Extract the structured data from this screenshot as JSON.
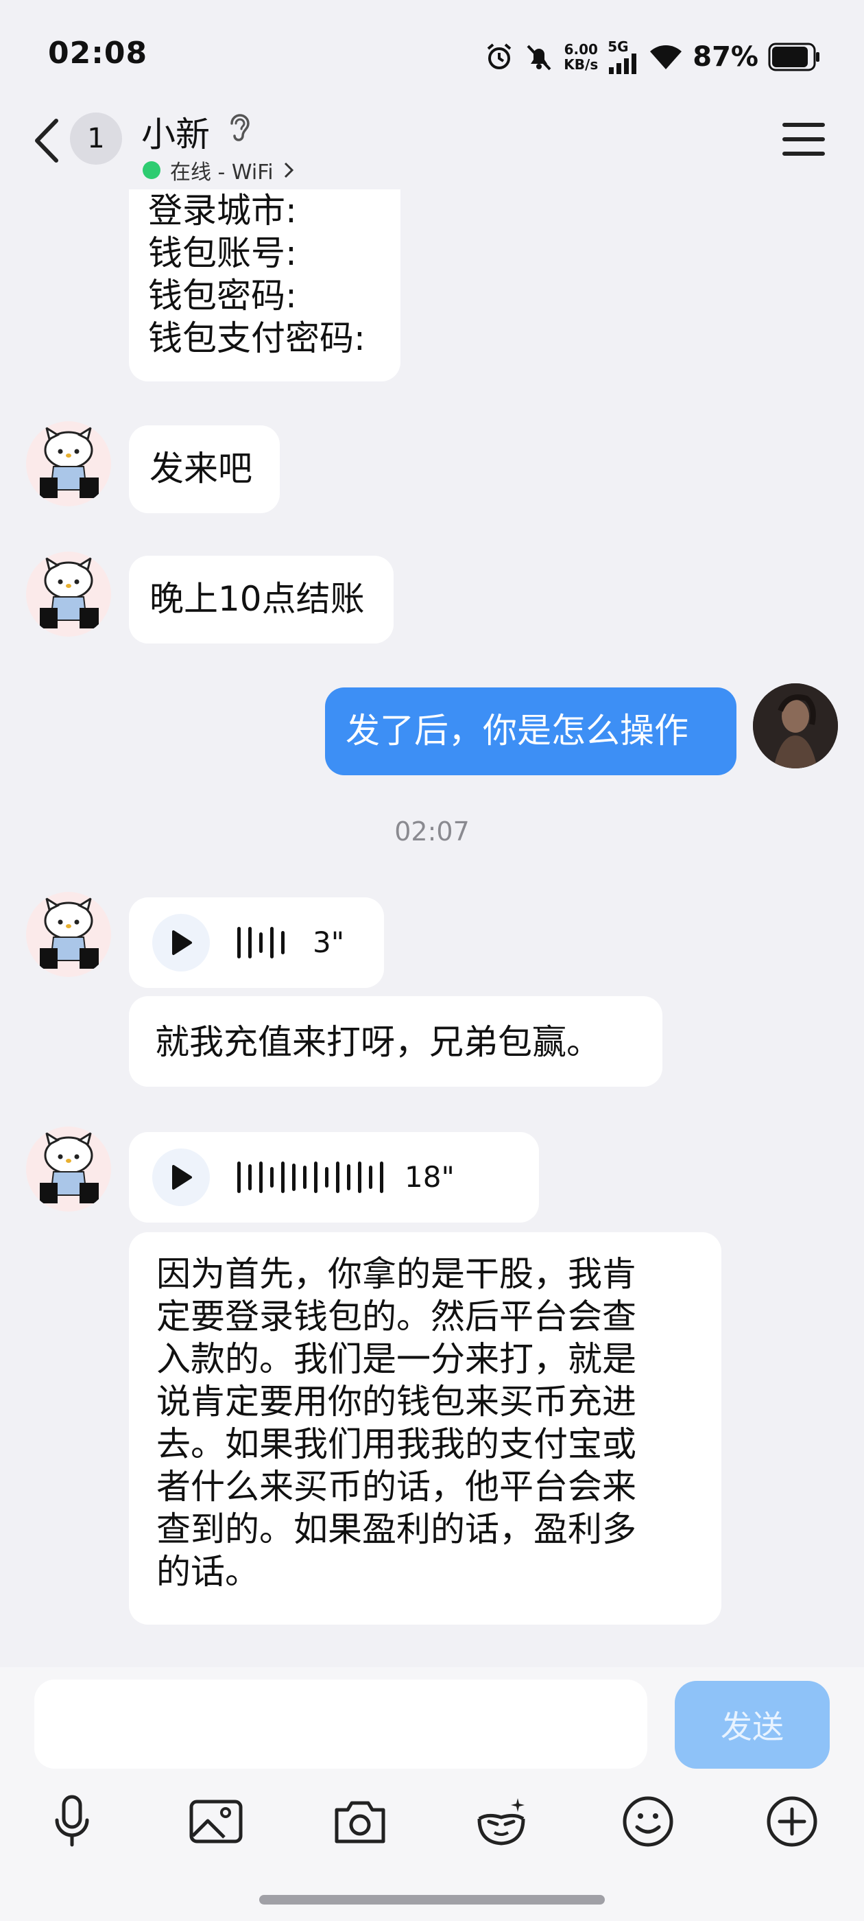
{
  "status_bar": {
    "time": "02:08",
    "speed_value": "6.00",
    "speed_unit": "KB/s",
    "network": "5G",
    "battery": "87%"
  },
  "header": {
    "unread_count": "1",
    "contact_name": "小新",
    "presence": "在线 - WiFi",
    "presence_color": "#2ecc71"
  },
  "messages": {
    "form_lines": [
      "登录城市:",
      "钱包账号:",
      "钱包密码:",
      "钱包支付密码:"
    ],
    "m2": "发来吧",
    "m3": "晚上10点结账",
    "m4": "发了后，你是怎么操作",
    "timestamp": "02:07",
    "voice1_duration": "3\"",
    "m6": "就我充值来打呀，兄弟包赢。",
    "voice2_duration": "18\"",
    "long_lines": [
      "因为首先，你拿的是干股，我肯",
      "定要登录钱包的。然后平台会查",
      "入款的。我们是一分来打，就是",
      "说肯定要用你的钱包来买币充进",
      "去。如果我们用我我的支付宝或",
      "者什么来买币的话，他平台会来",
      "查到的。如果盈利的话，盈利多",
      "的话。"
    ]
  },
  "input": {
    "placeholder": "",
    "send_label": "发送"
  },
  "colors": {
    "accent": "#3d8ff5",
    "send_disabled": "#8ec2f8",
    "background": "#f1f1f5"
  },
  "icons": [
    "microphone-icon",
    "image-icon",
    "camera-icon",
    "sticker-face-icon",
    "emoji-icon",
    "plus-icon"
  ]
}
